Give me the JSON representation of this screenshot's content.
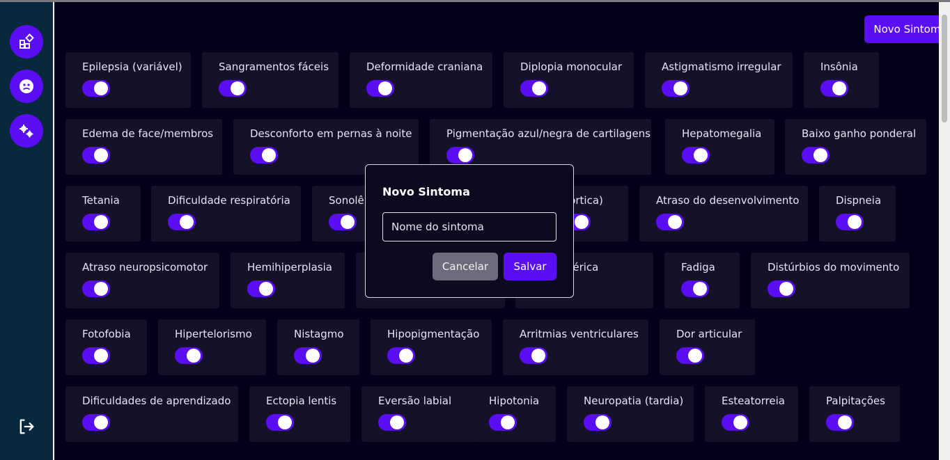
{
  "sidebar": {
    "icons": [
      "dashboard-icon",
      "patient-icon",
      "settings-icon"
    ],
    "logout_icon": "logout-icon"
  },
  "header": {
    "new_button_label": "Novo Sintoma"
  },
  "symptoms": [
    {
      "label": "Epilepsia (variável)",
      "enabled": true
    },
    {
      "label": "Sangramentos fáceis",
      "enabled": true
    },
    {
      "label": "Deformidade craniana",
      "enabled": true
    },
    {
      "label": "Diplopia monocular",
      "enabled": true
    },
    {
      "label": "Astigmatismo irregular",
      "enabled": true
    },
    {
      "label": "Insônia",
      "enabled": true
    },
    {
      "label": "Edema de face/membros",
      "enabled": true
    },
    {
      "label": "Desconforto em pernas à noite",
      "enabled": true
    },
    {
      "label": "Pigmentação azul/negra de cartilagens",
      "enabled": true
    },
    {
      "label": "Hepatomegalia",
      "enabled": true
    },
    {
      "label": "Baixo ganho ponderal",
      "enabled": true
    },
    {
      "label": "Tetania",
      "enabled": true
    },
    {
      "label": "Dificuldade respiratória",
      "enabled": true
    },
    {
      "label": "Sonolê",
      "enabled": true
    },
    {
      "label": "aórtica)",
      "enabled": true
    },
    {
      "label": "Atraso do desenvolvimento",
      "enabled": true
    },
    {
      "label": "Dispneia",
      "enabled": true
    },
    {
      "label": "Atraso neuropsicomotor",
      "enabled": true
    },
    {
      "label": "Hemihiperplasia",
      "enabled": true
    },
    {
      "label": "",
      "enabled": true
    },
    {
      "label": "tia periférica",
      "enabled": true
    },
    {
      "label": "Fadiga",
      "enabled": true
    },
    {
      "label": "Distúrbios do movimento",
      "enabled": true
    },
    {
      "label": "Fotofobia",
      "enabled": true
    },
    {
      "label": "Hipertelorismo",
      "enabled": true
    },
    {
      "label": "Nistagmo",
      "enabled": true
    },
    {
      "label": "Hipopigmentação",
      "enabled": true
    },
    {
      "label": "Arritmias ventriculares",
      "enabled": true
    },
    {
      "label": "Dor articular",
      "enabled": true
    },
    {
      "label": "Dificuldades de aprendizado",
      "enabled": true
    },
    {
      "label": "Ectopia lentis",
      "enabled": true
    },
    {
      "label": "Eversão labial",
      "enabled": true
    },
    {
      "label": "Hipotonia",
      "enabled": true
    },
    {
      "label": "Neuropatia (tardia)",
      "enabled": true
    },
    {
      "label": "Esteatorreia",
      "enabled": true
    },
    {
      "label": "Palpitações",
      "enabled": true
    }
  ],
  "modal": {
    "title": "Novo Sintoma",
    "input_placeholder": "Nome do sintoma",
    "input_value": "",
    "cancel_label": "Cancelar",
    "save_label": "Salvar"
  }
}
